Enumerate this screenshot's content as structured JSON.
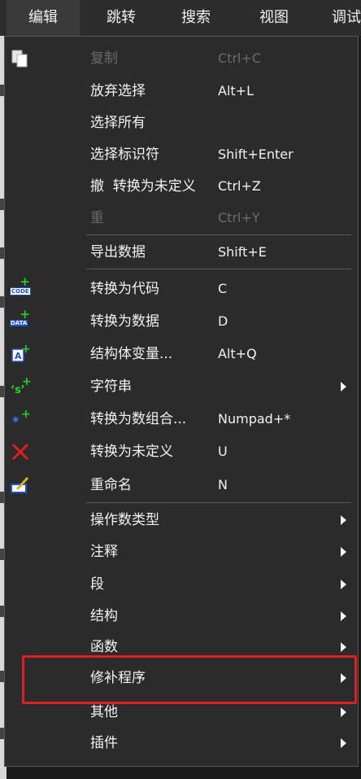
{
  "menubar": {
    "items": [
      {
        "label": "编辑",
        "active": true
      },
      {
        "label": "跳转"
      },
      {
        "label": "搜索"
      },
      {
        "label": "视图"
      },
      {
        "label": "调试"
      }
    ]
  },
  "menu": {
    "items": [
      {
        "label": "复制",
        "shortcut": "Ctrl+C",
        "disabled": true,
        "icon": "copy-icon"
      },
      {
        "label": "放弃选择",
        "shortcut": "Alt+L"
      },
      {
        "label": "选择所有",
        "shortcut": ""
      },
      {
        "label": "选择标识符",
        "shortcut": "Shift+Enter"
      },
      {
        "label": "撤  转换为未定义",
        "shortcut": "Ctrl+Z"
      },
      {
        "label": "重",
        "shortcut": "Ctrl+Y",
        "disabled": true
      },
      {
        "label": "导出数据",
        "shortcut": "Shift+E"
      },
      {
        "label": "转换为代码",
        "shortcut": "C",
        "icon": "code-icon",
        "icon_text": "CODE"
      },
      {
        "label": "转换为数据",
        "shortcut": "D",
        "icon": "data-icon",
        "icon_text": "DATA"
      },
      {
        "label": "结构体变量...",
        "shortcut": "Alt+Q",
        "icon": "struct-var-icon"
      },
      {
        "label": "字符串",
        "shortcut": "",
        "submenu": true,
        "icon": "string-icon"
      },
      {
        "label": "转换为数组合...",
        "shortcut": "Numpad+*",
        "icon": "array-icon"
      },
      {
        "label": "转换为未定义",
        "shortcut": "U",
        "icon": "undefine-icon"
      },
      {
        "label": "重命名",
        "shortcut": "N",
        "icon": "rename-icon"
      },
      {
        "label": "操作数类型",
        "submenu": true
      },
      {
        "label": "注释",
        "submenu": true
      },
      {
        "label": "段",
        "submenu": true
      },
      {
        "label": "结构",
        "submenu": true
      },
      {
        "label": "函数",
        "submenu": true
      },
      {
        "label": "修补程序",
        "submenu": true,
        "highlighted": true
      },
      {
        "label": "其他",
        "submenu": true
      },
      {
        "label": "插件",
        "submenu": true
      }
    ]
  },
  "colors": {
    "highlight_border": "#e02020",
    "menu_bg": "#2b2b2b",
    "disabled_text": "#6a6a6a",
    "text": "#f2f2f2"
  }
}
